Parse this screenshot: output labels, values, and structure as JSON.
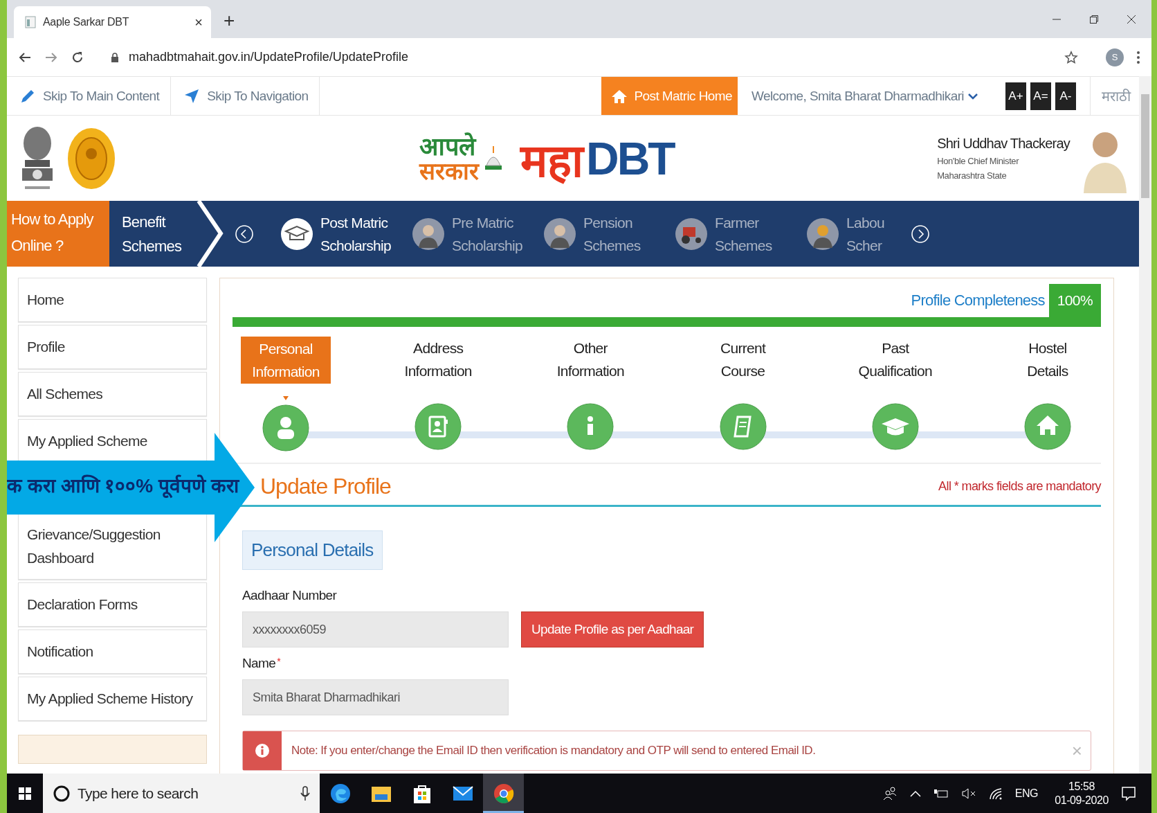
{
  "browser": {
    "tab_title": "Aaple Sarkar DBT",
    "tab_close": "×",
    "new_tab": "+",
    "url": "mahadbtmahait.gov.in/UpdateProfile/UpdateProfile",
    "profile_initial": "S"
  },
  "top_bar": {
    "skip_links": [
      "Skip To Main Content",
      "Skip To Navigation"
    ],
    "home_button": "Post Matric Home",
    "welcome": "Welcome, Smita Bharat Dharmadhikari",
    "font_buttons": [
      "A+",
      "A=",
      "A-"
    ],
    "language": "मराठी"
  },
  "header": {
    "logo_top": "आपले",
    "logo_bottom": "सरकार",
    "logo_maha": "महा",
    "logo_dbt": "DBT",
    "minister_name": "Shri Uddhav Thackeray",
    "minister_title": "Hon'ble Chief Minister",
    "minister_state": "Maharashtra State"
  },
  "nav": {
    "how_to": "How to Apply Online ?",
    "benefit": "Benefit Schemes",
    "items": [
      {
        "label": "Post Matric Scholarship",
        "kind": "cap",
        "selected": true
      },
      {
        "label": "Pre Matric Scholarship",
        "kind": "student",
        "selected": false
      },
      {
        "label": "Pension Schemes",
        "kind": "elder",
        "selected": false
      },
      {
        "label": "Farmer Schemes",
        "kind": "tractor",
        "selected": false
      },
      {
        "label": "Labou Scher",
        "kind": "worker",
        "selected": false
      }
    ]
  },
  "sidebar": {
    "items": [
      {
        "label": "Home"
      },
      {
        "label": "Profile"
      },
      {
        "label": "All Schemes"
      },
      {
        "label": "My Applied Scheme"
      },
      {
        "label": "Grievance/Suggestion Dashboard"
      },
      {
        "label": "Declaration Forms"
      },
      {
        "label": "Notification"
      },
      {
        "label": "My Applied Scheme History"
      }
    ]
  },
  "profile": {
    "completeness_label": "Profile Completeness",
    "completeness_value": "100%",
    "level": 1.0,
    "steps": [
      {
        "label": "Personal Information",
        "kind": "person",
        "selected": true
      },
      {
        "label": "Address Information",
        "kind": "contact",
        "selected": false
      },
      {
        "label": "Other Information",
        "kind": "info",
        "selected": false
      },
      {
        "label": "Current Course",
        "kind": "book",
        "selected": false
      },
      {
        "label": "Past Qualification",
        "kind": "cap",
        "selected": false
      },
      {
        "label": "Hostel Details",
        "kind": "home",
        "selected": false
      }
    ],
    "heading": "Update Profile",
    "mandatory_note": "All * marks fields are mandatory",
    "section_tab": "Personal Details",
    "fields": [
      {
        "label": "Aadhaar Number",
        "value": "xxxxxxxx6059"
      },
      {
        "label": "Name",
        "required_mark": "*",
        "value": "Smita Bharat Dharmadhikari"
      }
    ],
    "aadhaar_button": "Update Profile as per Aadhaar",
    "note": "Note: If you enter/change the Email ID then verification is mandatory and OTP will send to entered Email ID.",
    "note_close": "×"
  },
  "annotation": {
    "text": "क करा आणि १००% पूर्वपणे करा"
  },
  "taskbar": {
    "search_placeholder": "Type here to search",
    "apps": [
      {
        "kind": "edge",
        "selected": false
      },
      {
        "kind": "folder",
        "selected": false
      },
      {
        "kind": "store",
        "selected": false
      },
      {
        "kind": "mail",
        "selected": false
      },
      {
        "kind": "chrome",
        "selected": true
      }
    ],
    "language": "ENG",
    "time": "15:58",
    "date": "01-09-2020"
  }
}
